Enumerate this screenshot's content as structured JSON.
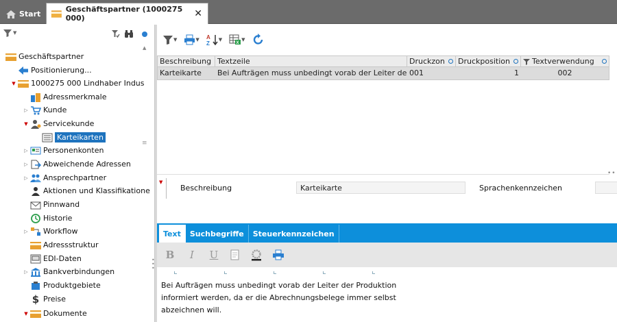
{
  "tabs": {
    "start_label": "Start",
    "active_label": "Geschäftspartner (1000275 000)",
    "close_glyph": "✕"
  },
  "tree": {
    "items": [
      {
        "label": "Geschäftspartner",
        "icon": "folder-icon"
      },
      {
        "label": "Positionierung...",
        "icon": "arrow-left-icon"
      },
      {
        "label": "1000275  000  Lindhaber Indus",
        "icon": "folder-icon"
      },
      {
        "label": "Adressmerkmale",
        "icon": "buildings-icon"
      },
      {
        "label": "Kunde",
        "icon": "cart-icon"
      },
      {
        "label": "Servicekunde",
        "icon": "person-icon"
      },
      {
        "label": "Karteikarten",
        "icon": "card-icon"
      },
      {
        "label": "Personenkonten",
        "icon": "accounts-icon"
      },
      {
        "label": "Abweichende Adressen",
        "icon": "document-arrow-icon"
      },
      {
        "label": "Ansprechpartner",
        "icon": "people-icon"
      },
      {
        "label": "Aktionen und Klassifikatione",
        "icon": "person-dark-icon"
      },
      {
        "label": "Pinnwand",
        "icon": "envelope-icon"
      },
      {
        "label": "Historie",
        "icon": "clock-icon"
      },
      {
        "label": "Workflow",
        "icon": "workflow-icon"
      },
      {
        "label": "Adressstruktur",
        "icon": "folder-icon"
      },
      {
        "label": "EDI-Daten",
        "icon": "edi-icon"
      },
      {
        "label": "Bankverbindungen",
        "icon": "bank-icon"
      },
      {
        "label": "Produktgebiete",
        "icon": "product-icon"
      },
      {
        "label": "Preise",
        "icon": "dollar-icon"
      },
      {
        "label": "Dokumente",
        "icon": "folder-icon"
      }
    ]
  },
  "grid": {
    "headers": [
      "Beschreibung",
      "Textzeile",
      "Druckzon",
      "Druckposition",
      "Textverwendung"
    ],
    "rows": [
      [
        "Karteikarte",
        "Bei Aufträgen muss unbedingt vorab der Leiter der",
        "001",
        "1",
        "002"
      ]
    ]
  },
  "detail": {
    "beschreibung_label": "Beschreibung",
    "beschreibung_value": "Karteikarte",
    "sprachen_label": "Sprachenkennzeichen"
  },
  "subtabs": [
    "Text",
    "Suchbegriffe",
    "Steuerkennzeichen"
  ],
  "format": {
    "bold": "B",
    "italic": "I",
    "underline": "U"
  },
  "editor": {
    "lines": [
      "Bei Aufträgen muss unbedingt vorab der Leiter der Produktion",
      "informiert werden, da er die Abrechnungsbelege immer selbst",
      "abzeichnen will."
    ]
  },
  "colors": {
    "accent": "#0d8fdb",
    "selection": "#1e73be",
    "tabbar": "#6b6b6b"
  }
}
